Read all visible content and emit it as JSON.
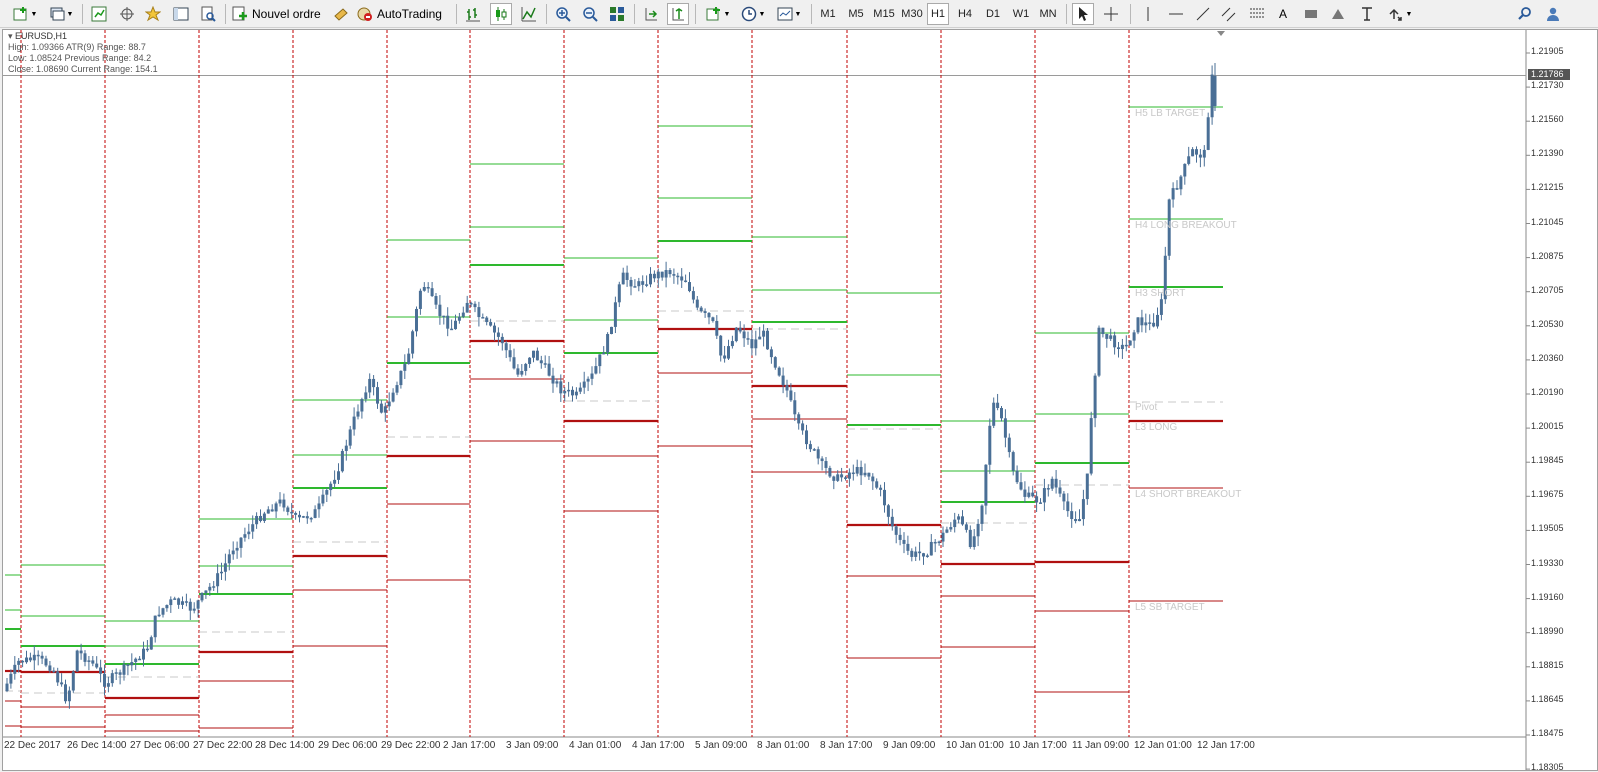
{
  "toolbar": {
    "new_order_label": "Nouvel ordre",
    "autotrading_label": "AutoTrading",
    "timeframes": [
      "M1",
      "M5",
      "M15",
      "M30",
      "H1",
      "H4",
      "D1",
      "W1",
      "MN"
    ],
    "active_timeframe": "H1",
    "text_tool_label": "A"
  },
  "chart": {
    "symbol": "EURUSD,H1",
    "info": {
      "high": "High:  1.09366   ATR(9) Range: 88.7",
      "low": "Low:   1.08524   Previous Range: 84.2",
      "close": "Close: 1.08690   Current Range: 154.1"
    },
    "current_price": "1.21786",
    "price_ticks": [
      "1.21905",
      "1.21730",
      "1.21560",
      "1.21390",
      "1.21215",
      "1.21045",
      "1.20875",
      "1.20705",
      "1.20530",
      "1.20360",
      "1.20190",
      "1.20015",
      "1.19845",
      "1.19675",
      "1.19505",
      "1.19330",
      "1.19160",
      "1.18990",
      "1.18815",
      "1.18645",
      "1.18475",
      "1.18305"
    ],
    "date_ticks": [
      "22 Dec 2017",
      "26 Dec 14:00",
      "27 Dec 06:00",
      "27 Dec 22:00",
      "28 Dec 14:00",
      "29 Dec 06:00",
      "29 Dec 22:00",
      "2 Jan 17:00",
      "3 Jan 09:00",
      "4 Jan 01:00",
      "4 Jan 17:00",
      "5 Jan 09:00",
      "8 Jan 01:00",
      "8 Jan 17:00",
      "9 Jan 09:00",
      "10 Jan 01:00",
      "10 Jan 17:00",
      "11 Jan 09:00",
      "12 Jan 01:00",
      "12 Jan 17:00"
    ],
    "level_labels": {
      "h5": "H5 LB TARGET",
      "h4": "H4 LONG BREAKOUT",
      "h3": "H3 SHORT",
      "pivot": "Pivot",
      "l3": "L3 LONG",
      "l4": "L4 SHORT BREAKOUT",
      "l5": "L5 SB TARGET"
    },
    "colors": {
      "candle": "#4a6f96",
      "green": "#2eb82e",
      "red": "#b01010",
      "separator": "#c00000",
      "pivot": "#c8c8c8"
    }
  }
}
